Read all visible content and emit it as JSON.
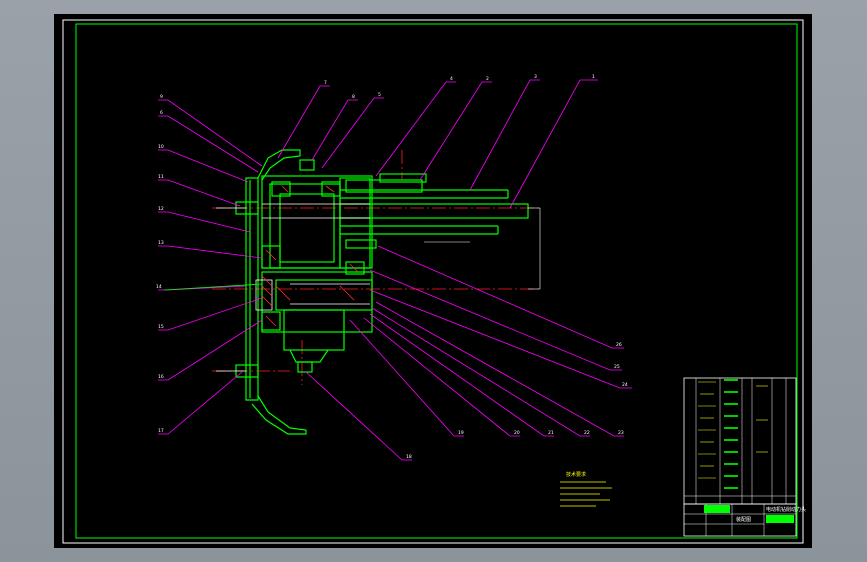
{
  "drawing": {
    "leaders": [
      "1",
      "2",
      "3",
      "4",
      "5",
      "6",
      "7",
      "8",
      "9",
      "10",
      "11",
      "12",
      "13",
      "14",
      "15",
      "16",
      "17",
      "18",
      "19",
      "20",
      "21",
      "22",
      "23",
      "24",
      "25",
      "26"
    ],
    "notes_title": "技术要求",
    "title_block": {
      "title": "电动机钻削动力头",
      "drawing_name": "装配图"
    }
  },
  "colors": {
    "paper": "#000000",
    "border": "#ffffff",
    "frame": "#00ff00",
    "outline": "#00ff00",
    "detail": "#ffffff",
    "leader": "#ff00ff",
    "centerline": "#ff2020",
    "hatch": "#ff3030",
    "text": "#ffff00",
    "cyan": "#00ffff"
  }
}
